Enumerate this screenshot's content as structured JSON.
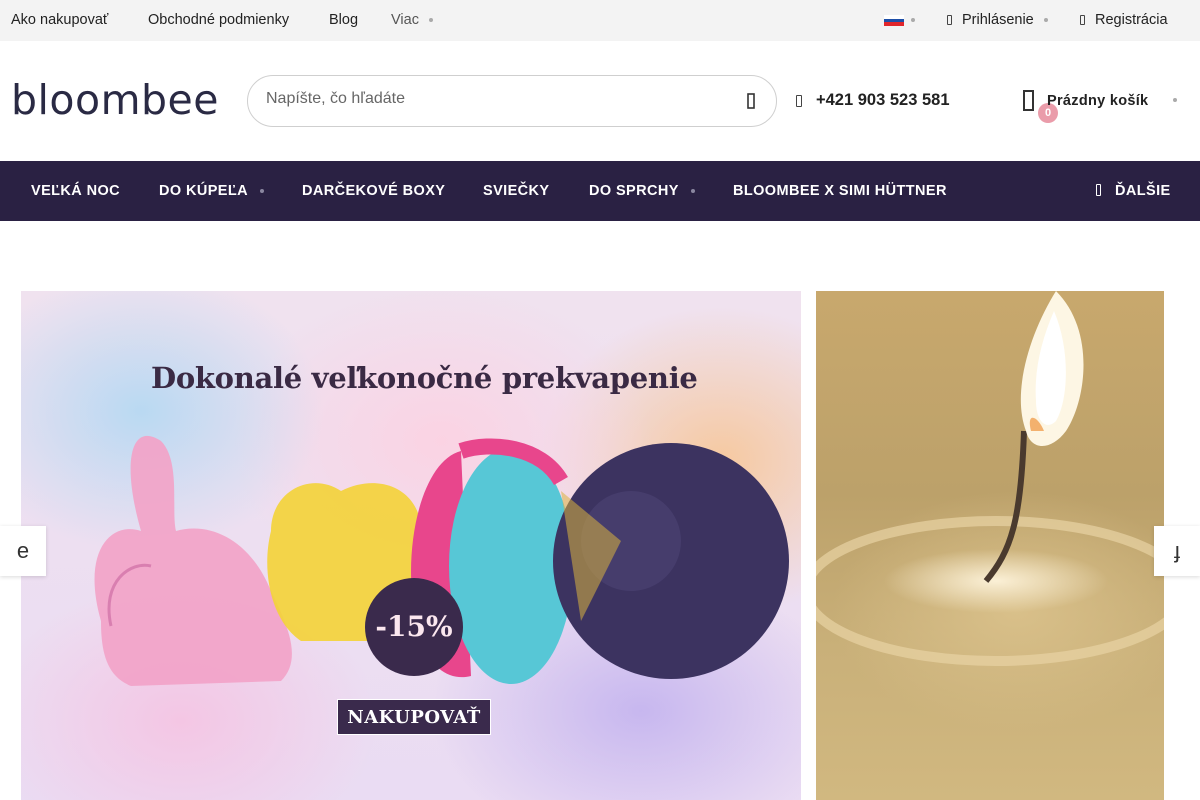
{
  "topbar": {
    "links": [
      "Ako nakupovať",
      "Obchodné podmienky",
      "Blog",
      "Viac"
    ],
    "login_label": "Prihlásenie",
    "register_label": "Registrácia",
    "language_flag": "slovak-flag"
  },
  "header": {
    "logo_text": "bloombee",
    "search": {
      "placeholder": "Napíšte, čo hľadáte",
      "value": ""
    },
    "phone": "+421 903 523 581",
    "cart": {
      "count": "0",
      "label": "Prázdny košík"
    }
  },
  "nav": {
    "items": [
      {
        "label": "VEĽKÁ NOC"
      },
      {
        "label": "DO KÚPEĽA"
      },
      {
        "label": "DARČEKOVÉ BOXY"
      },
      {
        "label": "SVIEČKY"
      },
      {
        "label": "DO SPRCHY"
      },
      {
        "label": "BLOOMBEE X SIMI HÜTTNER"
      }
    ],
    "more_label": "ĎALŠIE"
  },
  "carousel": {
    "slide1": {
      "title": "Dokonalé veľkonočné prekvapenie",
      "discount": "-15%",
      "cta": "NAKUPOVAŤ"
    },
    "prev_label": "e",
    "next_label": "ɟ"
  },
  "colors": {
    "nav_bg": "#2a2143",
    "accent_badge": "#ea9caa",
    "topbar_bg": "#f3f3f3",
    "banner_dark": "#3a2a4c"
  }
}
